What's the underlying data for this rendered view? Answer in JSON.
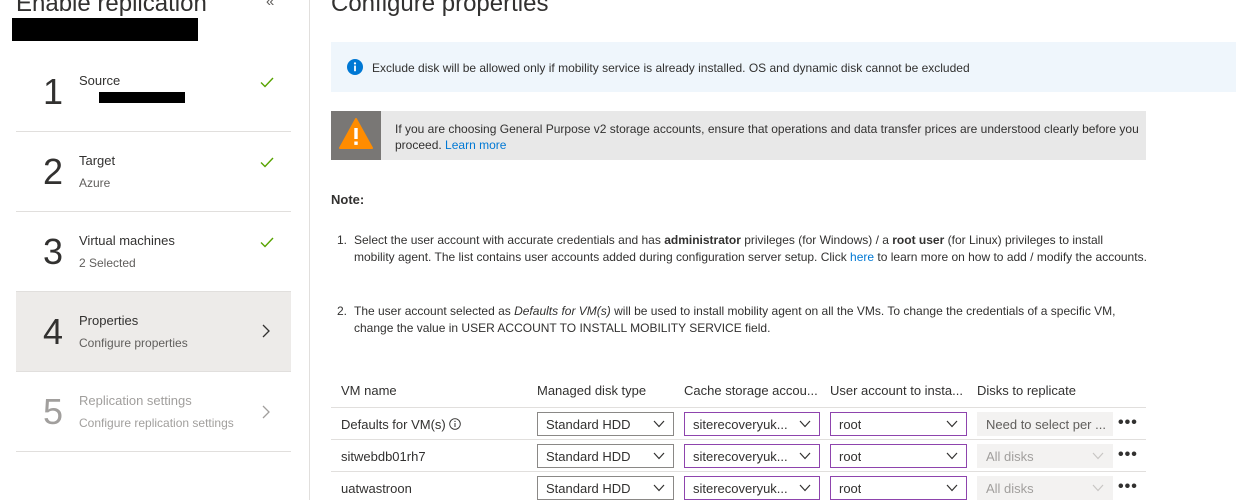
{
  "left": {
    "title": "Enable replication",
    "collapse_glyph": "«",
    "steps": [
      {
        "num": "1",
        "title": "Source",
        "subtitle": "",
        "status": "done"
      },
      {
        "num": "2",
        "title": "Target",
        "subtitle": "Azure",
        "status": "done"
      },
      {
        "num": "3",
        "title": "Virtual machines",
        "subtitle": "2 Selected",
        "status": "done"
      },
      {
        "num": "4",
        "title": "Properties",
        "subtitle": "Configure properties",
        "status": "active"
      },
      {
        "num": "5",
        "title": "Replication settings",
        "subtitle": "Configure replication settings",
        "status": "disabled"
      }
    ]
  },
  "main": {
    "title": "Configure properties",
    "info_banner": "Exclude disk will be allowed only if mobility service is already installed. OS and dynamic disk cannot be excluded",
    "warning_banner": "If you are choosing General Purpose v2 storage accounts, ensure that operations and data transfer prices are understood clearly before you proceed.",
    "warning_link": "Learn more",
    "note_label": "Note:",
    "notes": {
      "n1_num": "1.",
      "n1_a": "Select the user account with accurate credentials and has ",
      "n1_b": "administrator",
      "n1_c": " privileges (for Windows) / a ",
      "n1_d": "root user",
      "n1_e": " (for Linux) privileges to install mobility agent. The list contains user accounts added during configuration server setup. Click ",
      "n1_link": "here",
      "n1_f": " to learn more on how to add / modify the accounts.",
      "n2_num": "2.",
      "n2_a": "The user account selected as ",
      "n2_b": "Defaults for VM(s)",
      "n2_c": " will be used to install mobility agent on all the VMs. To change the credentials of a specific VM, change the value in USER ACCOUNT TO INSTALL MOBILITY SERVICE field."
    },
    "table": {
      "headers": [
        "VM name",
        "Managed disk type",
        "Cache storage accou...",
        "User account to insta...",
        "Disks to replicate"
      ],
      "rows": [
        {
          "name": "Defaults for VM(s)",
          "disk": "Standard HDD",
          "cache": "siterecoveryuk...",
          "user": "root",
          "disks": "Need to select per ..."
        },
        {
          "name": "sitwebdb01rh7",
          "disk": "Standard HDD",
          "cache": "siterecoveryuk...",
          "user": "root",
          "disks": "All disks"
        },
        {
          "name": "uatwastroon",
          "disk": "Standard HDD",
          "cache": "siterecoveryuk...",
          "user": "root",
          "disks": "All disks"
        }
      ],
      "more_glyph": "•••"
    }
  },
  "colors": {
    "check": "#57a300",
    "info": "#0078d4",
    "warning": "#ff8c00",
    "purple_border": "#8e44ad"
  }
}
